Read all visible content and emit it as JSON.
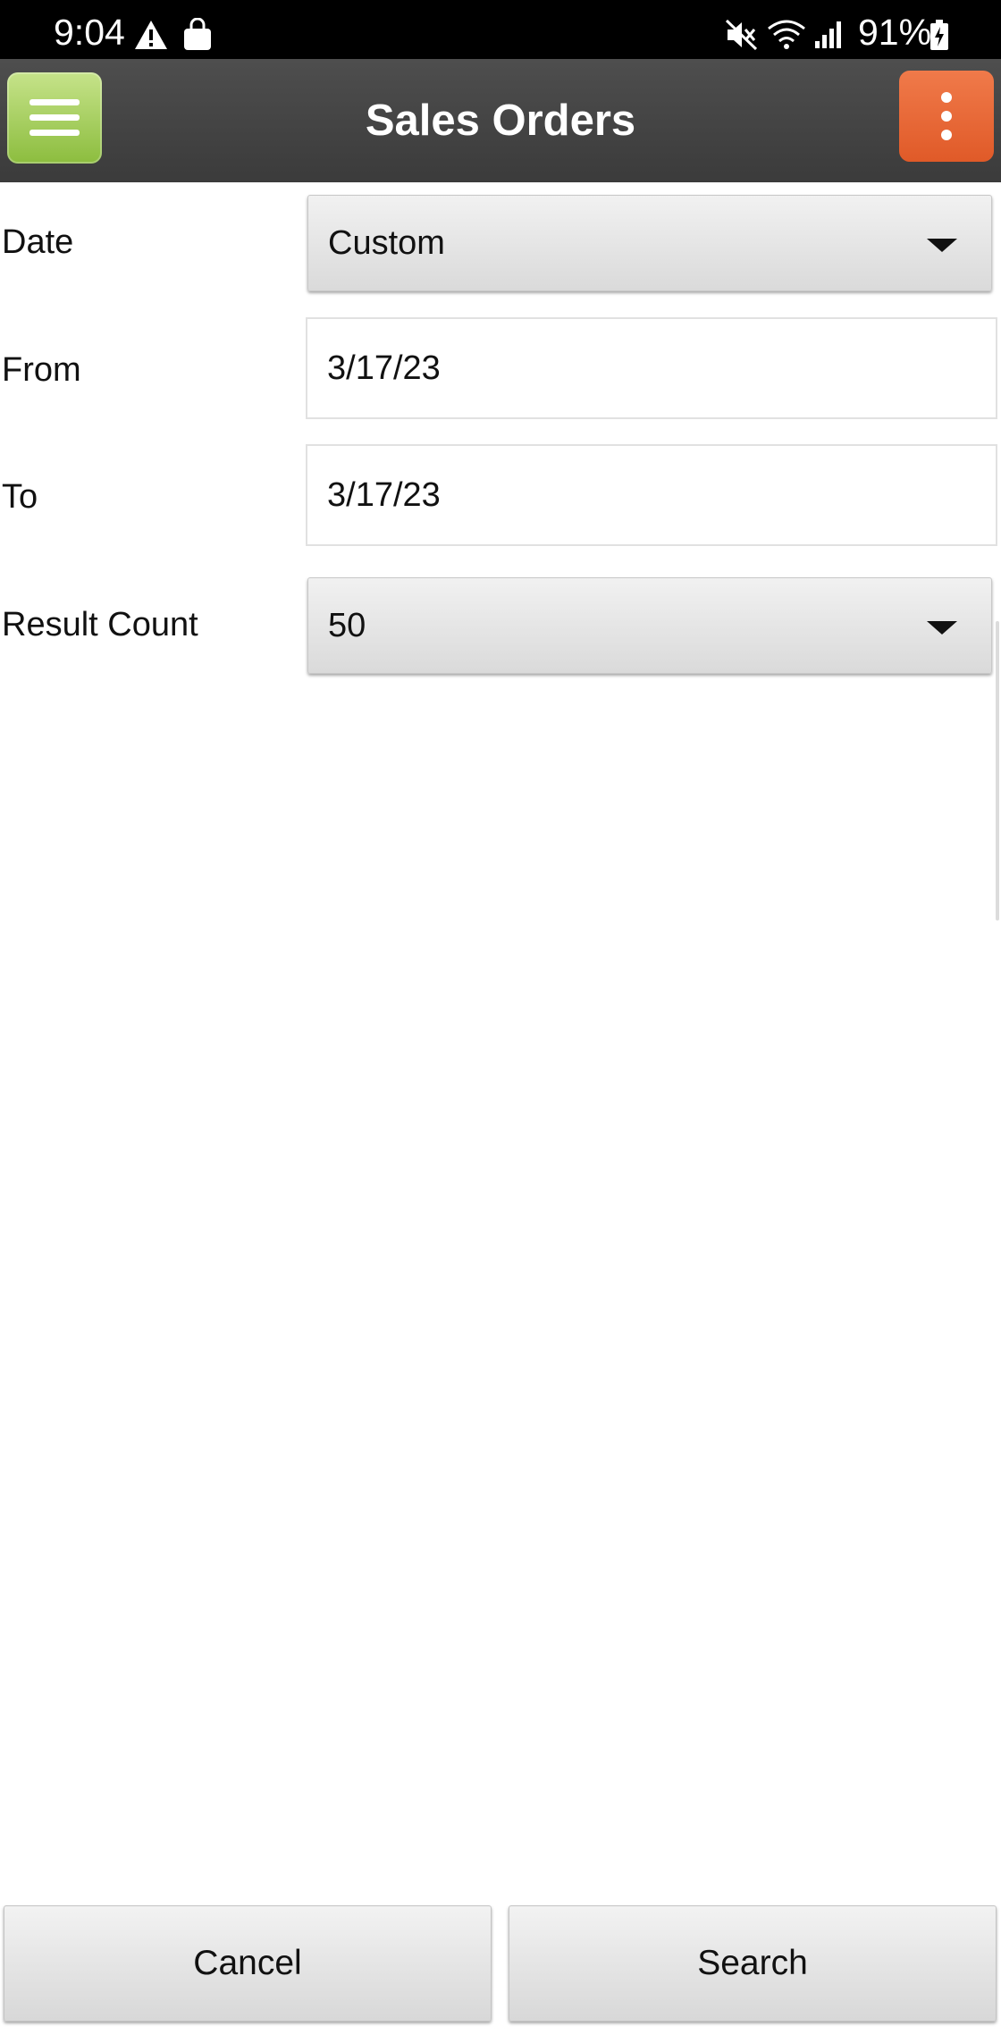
{
  "status_bar": {
    "time": "9:04",
    "battery": "91%",
    "icons": [
      "warning-icon",
      "shopping-bag-icon",
      "mute-icon",
      "wifi-icon",
      "signal-icon",
      "battery-icon"
    ]
  },
  "header": {
    "title": "Sales Orders",
    "menu_icon": "hamburger-menu-icon",
    "more_icon": "more-vert-icon",
    "colors": {
      "menu_button": "#9dc94a",
      "more_button": "#e8663a",
      "bar": "#444444"
    }
  },
  "form": {
    "date": {
      "label": "Date",
      "value": "Custom"
    },
    "from": {
      "label": "From",
      "value": "3/17/23"
    },
    "to": {
      "label": "To",
      "value": "3/17/23"
    },
    "result_count": {
      "label": "Result Count",
      "value": "50"
    }
  },
  "footer": {
    "cancel_label": "Cancel",
    "search_label": "Search"
  }
}
